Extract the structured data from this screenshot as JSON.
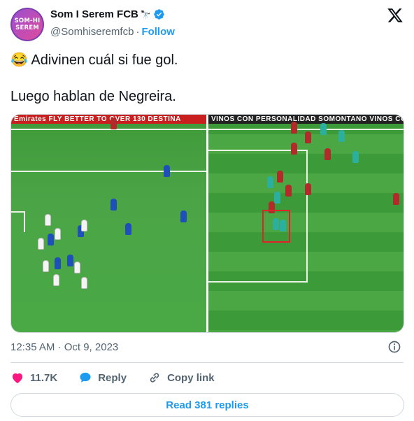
{
  "author": {
    "display_name": "Som I Serem FCB",
    "handle": "@Somhiseremfcb",
    "separator": "·",
    "follow_label": "Follow",
    "avatar_text_line1": "SOM-HI",
    "avatar_text_line2": "SEREM",
    "badge_emoji": "🔭"
  },
  "tweet": {
    "line1_emoji": "😂",
    "line1": "Adivinen cuál si fue gol.",
    "line2": "Luego hablan de Negreira."
  },
  "media": {
    "left_banner": "Emirates   FLY BETTER TO OVER 130 DESTINA",
    "right_banner": "VINOS CON PERSONALIDAD   SOMONTANO   VINOS CON PE"
  },
  "meta": {
    "timestamp": "12:35 AM · Oct 9, 2023"
  },
  "actions": {
    "likes": "11.7K",
    "reply_label": "Reply",
    "copy_link_label": "Copy link"
  },
  "read_replies_label": "Read 381 replies",
  "colors": {
    "accent": "#1d9bf0",
    "like": "#f91880",
    "text_secondary": "#536471"
  }
}
